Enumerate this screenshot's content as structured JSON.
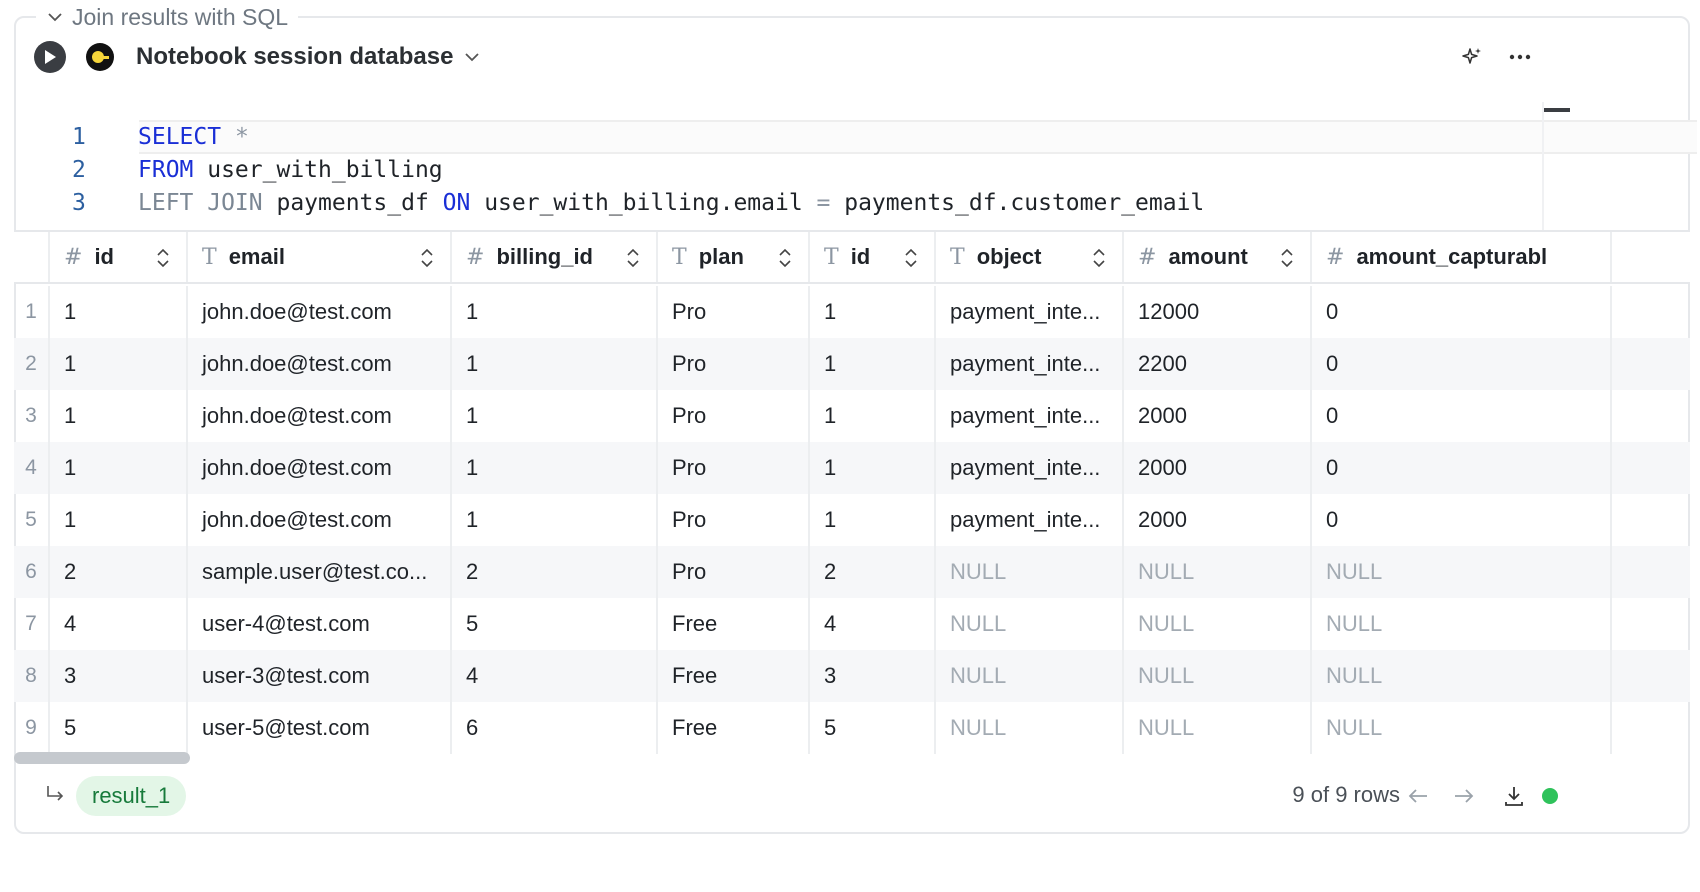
{
  "cell": {
    "title": "Join results with SQL"
  },
  "toolbar": {
    "database_label": "Notebook session database"
  },
  "editor": {
    "lines": [
      {
        "num": "1",
        "tokens": [
          {
            "t": "SELECT",
            "c": "kw-blue"
          },
          {
            "t": " ",
            "c": ""
          },
          {
            "t": "*",
            "c": "op"
          }
        ]
      },
      {
        "num": "2",
        "tokens": [
          {
            "t": "FROM",
            "c": "kw-blue"
          },
          {
            "t": " user_with_billing",
            "c": ""
          }
        ]
      },
      {
        "num": "3",
        "tokens": [
          {
            "t": "LEFT JOIN",
            "c": "kw-grey"
          },
          {
            "t": " payments_df ",
            "c": ""
          },
          {
            "t": "ON",
            "c": "kw-blue"
          },
          {
            "t": " user_with_billing.email ",
            "c": ""
          },
          {
            "t": "=",
            "c": "op"
          },
          {
            "t": " payments_df.customer_email",
            "c": ""
          }
        ]
      }
    ]
  },
  "table": {
    "columns": [
      {
        "type": "#",
        "name": "id"
      },
      {
        "type": "T",
        "name": "email"
      },
      {
        "type": "#",
        "name": "billing_id"
      },
      {
        "type": "T",
        "name": "plan"
      },
      {
        "type": "T",
        "name": "id"
      },
      {
        "type": "T",
        "name": "object"
      },
      {
        "type": "#",
        "name": "amount"
      },
      {
        "type": "#",
        "name": "amount_capturabl"
      }
    ],
    "rows": [
      {
        "rn": "1",
        "cells": [
          "1",
          "john.doe@test.com",
          "1",
          "Pro",
          "1",
          "payment_inte...",
          "12000",
          "0"
        ]
      },
      {
        "rn": "2",
        "cells": [
          "1",
          "john.doe@test.com",
          "1",
          "Pro",
          "1",
          "payment_inte...",
          "2200",
          "0"
        ]
      },
      {
        "rn": "3",
        "cells": [
          "1",
          "john.doe@test.com",
          "1",
          "Pro",
          "1",
          "payment_inte...",
          "2000",
          "0"
        ]
      },
      {
        "rn": "4",
        "cells": [
          "1",
          "john.doe@test.com",
          "1",
          "Pro",
          "1",
          "payment_inte...",
          "2000",
          "0"
        ]
      },
      {
        "rn": "5",
        "cells": [
          "1",
          "john.doe@test.com",
          "1",
          "Pro",
          "1",
          "payment_inte...",
          "2000",
          "0"
        ]
      },
      {
        "rn": "6",
        "cells": [
          "2",
          "sample.user@test.co...",
          "2",
          "Pro",
          "2",
          "NULL",
          "NULL",
          "NULL"
        ]
      },
      {
        "rn": "7",
        "cells": [
          "4",
          "user-4@test.com",
          "5",
          "Free",
          "4",
          "NULL",
          "NULL",
          "NULL"
        ]
      },
      {
        "rn": "8",
        "cells": [
          "3",
          "user-3@test.com",
          "4",
          "Free",
          "3",
          "NULL",
          "NULL",
          "NULL"
        ]
      },
      {
        "rn": "9",
        "cells": [
          "5",
          "user-5@test.com",
          "6",
          "Free",
          "5",
          "NULL",
          "NULL",
          "NULL"
        ]
      }
    ]
  },
  "footer": {
    "result_name": "result_1",
    "rows_info": "9 of 9 rows",
    "status_color": "#2fc25b"
  },
  "icons": [
    "chevron-down-icon",
    "play-icon",
    "database-icon",
    "sparkle-icon",
    "more-icon",
    "sort-icon",
    "return-arrow-icon",
    "arrow-left-icon",
    "arrow-right-icon",
    "download-icon"
  ]
}
